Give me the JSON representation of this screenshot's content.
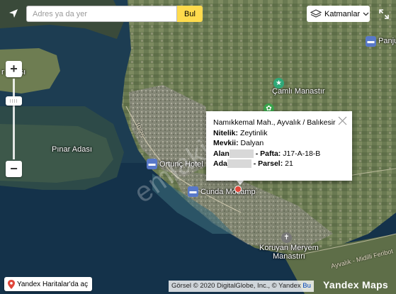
{
  "search": {
    "placeholder": "Adres ya da yer",
    "button_label": "Bul"
  },
  "layers": {
    "label": "Katmanlar"
  },
  "places": {
    "rupe_adasi": "r Adası",
    "pinar_adasi": "Pınar Adası",
    "camli_manastir": "Çamlı Manastır",
    "ortunc_hotel": "Ortunç Hotel",
    "cunda_mocamp": "Cunda Mocamp",
    "koruyan_line1": "Koruyan Meryem",
    "koruyan_line2": "Manastırı",
    "panjur": "Panjur",
    "road_label": "Ayvalık - Midilli Feribot",
    "road_number": "10/25"
  },
  "popup": {
    "address": "Namıkkemal Mah., Ayvalık / Balıkesir",
    "nitelik_label": "Nitelik:",
    "nitelik_value": "Zeytinlik",
    "mevkii_label": "Mevkii:",
    "mevkii_value": "Dalyan",
    "alan_label": "Alan",
    "pafta_label": "- Pafta:",
    "pafta_value": "J17-A-18-B",
    "ada_label": "Ada",
    "parsel_label": "- Parsel:",
    "parsel_value": "21"
  },
  "watermark": "emlakjet",
  "footer": {
    "open_in_yandex": "Yandex Haritalar'da aç",
    "copyright_prefix": "Görsel © 2020 DigitalGlobe, Inc., © Yandex",
    "copyright_link": "Bu",
    "brand": "Yandex Maps"
  },
  "colors": {
    "search_button": "#ffdb4d",
    "marker": "#e0463a",
    "link": "#0044bb"
  },
  "icons": [
    "locate-icon",
    "layers-icon",
    "chevron-down-icon",
    "fullscreen-icon",
    "close-icon",
    "map-pin-icon",
    "hotel-icon",
    "park-icon",
    "star-icon",
    "church-icon"
  ]
}
